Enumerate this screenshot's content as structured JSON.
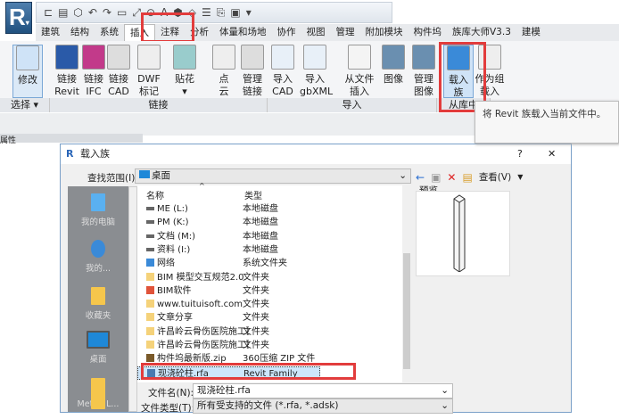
{
  "app": {
    "logo": "R"
  },
  "qat": {
    "icons": [
      "open-icon",
      "save-icon",
      "sync-icon",
      "undo-icon",
      "redo-icon",
      "measure-icon",
      "dimension-icon",
      "tag-icon",
      "text-icon",
      "3d-view-icon",
      "section-icon",
      "thin-lines-icon",
      "close-hidden-icon",
      "switch-windows-icon",
      "customize-icon"
    ]
  },
  "tabs": [
    "建筑",
    "结构",
    "系统",
    "插入",
    "注释",
    "分析",
    "体量和场地",
    "协作",
    "视图",
    "管理",
    "附加模块",
    "构件坞",
    "族库大师V3.3",
    "建模"
  ],
  "active_tab": "插入",
  "ribbon": {
    "buttons": [
      {
        "l1": "修改",
        "l2": ""
      },
      {
        "l1": "链接",
        "l2": "Revit"
      },
      {
        "l1": "链接",
        "l2": "IFC"
      },
      {
        "l1": "链接",
        "l2": "CAD"
      },
      {
        "l1": "DWF",
        "l2": "标记"
      },
      {
        "l1": "贴花",
        "l2": "▾"
      },
      {
        "l1": "点",
        "l2": "云"
      },
      {
        "l1": "管理",
        "l2": "链接"
      },
      {
        "l1": "导入",
        "l2": "CAD"
      },
      {
        "l1": "导入",
        "l2": "gbXML"
      },
      {
        "l1": "从文件",
        "l2": "插入"
      },
      {
        "l1": "图像",
        "l2": ""
      },
      {
        "l1": "管理",
        "l2": "图像"
      },
      {
        "l1": "载入",
        "l2": "族"
      },
      {
        "l1": "作为组",
        "l2": "载入"
      }
    ],
    "groups": [
      "选择 ▾",
      "链接",
      "导入",
      "从库中"
    ]
  },
  "tooltip": "将 Revit 族载入当前文件中。",
  "panel": {
    "title": "属性"
  },
  "dialog": {
    "title": "载入族",
    "help": "?",
    "close": "✕",
    "look_in_label": "查找范围(I):",
    "look_in_value": "桌面",
    "view_label": "查看(V)",
    "preview_label": "预览",
    "places": [
      "我的电脑",
      "我的...",
      "收藏夹",
      "桌面",
      "Metric L..."
    ],
    "columns": {
      "name": "名称",
      "type": "类型"
    },
    "files": [
      {
        "name": "ME (L:)",
        "type": "本地磁盘",
        "icon": "drive"
      },
      {
        "name": "PM (K:)",
        "type": "本地磁盘",
        "icon": "drive"
      },
      {
        "name": "文档 (M:)",
        "type": "本地磁盘",
        "icon": "drive"
      },
      {
        "name": "资料 (I:)",
        "type": "本地磁盘",
        "icon": "drive"
      },
      {
        "name": "网络",
        "type": "系统文件夹",
        "icon": "network"
      },
      {
        "name": "BIM 模型交互规范2.0",
        "type": "文件夹",
        "icon": "folder"
      },
      {
        "name": "BIM软件",
        "type": "文件夹",
        "icon": "app"
      },
      {
        "name": "www.tuituisoft.com",
        "type": "文件夹",
        "icon": "folder"
      },
      {
        "name": "文章分享",
        "type": "文件夹",
        "icon": "folder"
      },
      {
        "name": "许昌岭云骨伤医院施工图C...",
        "type": "文件夹",
        "icon": "folder"
      },
      {
        "name": "许昌岭云骨伤医院施工图C...",
        "type": "文件夹",
        "icon": "folder"
      },
      {
        "name": "构件坞最新版.zip",
        "type": "360压缩 ZIP 文件",
        "icon": "zip"
      },
      {
        "name": "现浇砼柱.rfa",
        "type": "Revit Family",
        "icon": "rfa",
        "selected": true
      }
    ],
    "filename_label": "文件名(N):",
    "filename_value": "现浇砼柱.rfa",
    "filetype_label": "文件类型(T):",
    "filetype_value": "所有受支持的文件 (*.rfa, *.adsk)"
  }
}
